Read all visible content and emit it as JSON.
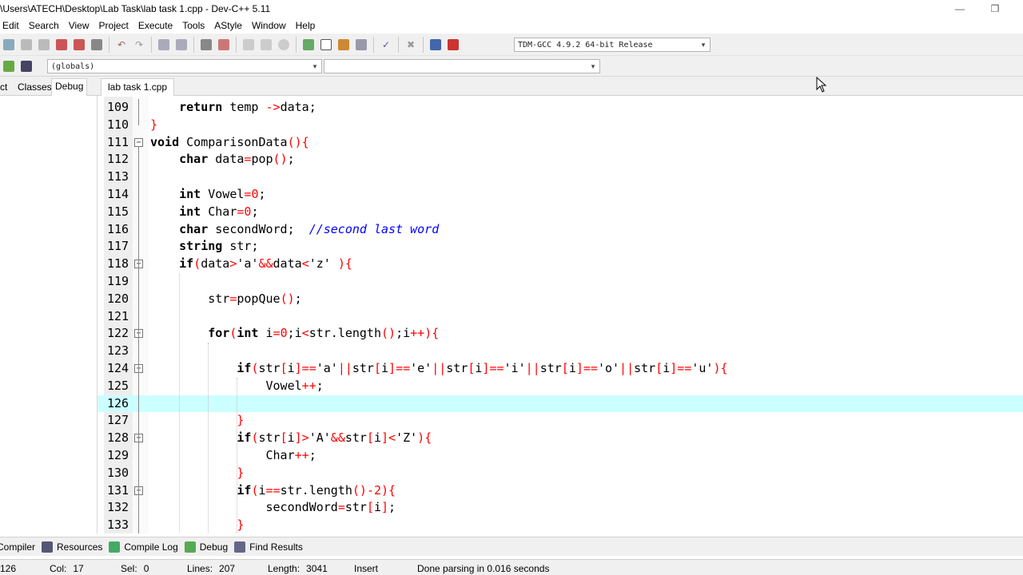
{
  "window": {
    "title": "\\Users\\ATECH\\Desktop\\Lab Task\\lab task 1.cpp - Dev-C++ 5.11",
    "minimize_icon": "minimize-icon",
    "restore_icon": "restore-icon"
  },
  "menu": [
    "Edit",
    "Search",
    "View",
    "Project",
    "Execute",
    "Tools",
    "AStyle",
    "Window",
    "Help"
  ],
  "toolbar": {
    "compiler_select": "TDM-GCC 4.9.2 64-bit Release",
    "scope_select": "(globals)",
    "function_select": ""
  },
  "left_panel": {
    "tabs": [
      "ct",
      "Classes",
      "Debug"
    ],
    "active_tab": "Debug"
  },
  "editor": {
    "tab_label": "lab task 1.cpp",
    "current_line": "126",
    "lines": [
      {
        "n": "109",
        "text": "    return temp ->data;"
      },
      {
        "n": "110",
        "text": "}"
      },
      {
        "n": "111",
        "text": "void ComparisonData(){"
      },
      {
        "n": "112",
        "text": "    char data=pop();"
      },
      {
        "n": "113",
        "text": ""
      },
      {
        "n": "114",
        "text": "    int Vowel=0;"
      },
      {
        "n": "115",
        "text": "    int Char=0;"
      },
      {
        "n": "116",
        "text": "    char secondWord;  //second last word"
      },
      {
        "n": "117",
        "text": "    string str;"
      },
      {
        "n": "118",
        "text": "    if(data>'a'&&data<'z' ){"
      },
      {
        "n": "119",
        "text": ""
      },
      {
        "n": "120",
        "text": "        str=popQue();"
      },
      {
        "n": "121",
        "text": ""
      },
      {
        "n": "122",
        "text": "        for(int i=0;i<str.length();i++){"
      },
      {
        "n": "123",
        "text": ""
      },
      {
        "n": "124",
        "text": "            if(str[i]=='a'||str[i]=='e'||str[i]=='i'||str[i]=='o'||str[i]=='u'){"
      },
      {
        "n": "125",
        "text": "                Vowel++;"
      },
      {
        "n": "126",
        "text": ""
      },
      {
        "n": "127",
        "text": "            }"
      },
      {
        "n": "128",
        "text": "            if(str[i]>'A'&&str[i]<'Z'){"
      },
      {
        "n": "129",
        "text": "                Char++;"
      },
      {
        "n": "130",
        "text": "            }"
      },
      {
        "n": "131",
        "text": "            if(i==str.length()-2){"
      },
      {
        "n": "132",
        "text": "                secondWord=str[i];"
      },
      {
        "n": "133",
        "text": "            }"
      }
    ]
  },
  "bottom_tabs": [
    {
      "label": "Compiler",
      "icon": "compiler-icon"
    },
    {
      "label": "Resources",
      "icon": "resources-icon"
    },
    {
      "label": "Compile Log",
      "icon": "compile-log-icon"
    },
    {
      "label": "Debug",
      "icon": "debug-icon"
    },
    {
      "label": "Find Results",
      "icon": "find-results-icon"
    }
  ],
  "status": {
    "line": "126",
    "col_label": "Col:",
    "col": "17",
    "sel_label": "Sel:",
    "sel": "0",
    "lines_label": "Lines:",
    "lines": "207",
    "length_label": "Length:",
    "length": "3041",
    "mode": "Insert",
    "message": "Done parsing in 0.016 seconds"
  },
  "colors": {
    "current_line": "#ccffff",
    "keyword": "#000000",
    "number": "#ff0000",
    "comment": "#0000ff"
  }
}
